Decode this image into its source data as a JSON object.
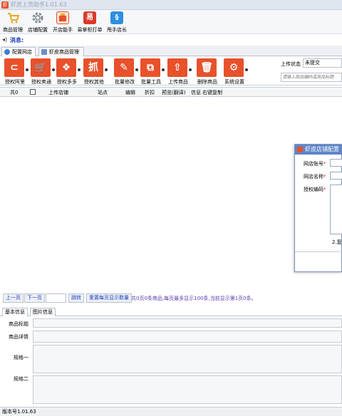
{
  "window": {
    "title": "虾皮上货助手1.01.63"
  },
  "top_toolbar": [
    {
      "label": "商品管理",
      "icon": "cart-icon",
      "color": "#e9a825"
    },
    {
      "label": "店铺配置",
      "icon": "gear-icon",
      "color": "#7d8591"
    },
    {
      "label": "开店能手",
      "icon": "shop-icon",
      "color": "#e8512b"
    },
    {
      "label": "易掌柜打单",
      "icon": "print-icon",
      "color": "#d93a2b"
    },
    {
      "label": "甩手店长",
      "icon": "app-icon",
      "color": "#2d8fe0"
    }
  ],
  "message": {
    "label": "消息:"
  },
  "tabs": [
    {
      "label": "配置网店",
      "active": true
    },
    {
      "label": "虾皮商品管理",
      "active": false
    }
  ],
  "tools": [
    {
      "label": "授权阿里",
      "glyph": "◎",
      "color": "#e8512b"
    },
    {
      "label": "授权卖通",
      "glyph": "⛟",
      "color": "#e8512b"
    },
    {
      "label": "授权多多",
      "glyph": "❖",
      "color": "#e8512b"
    },
    {
      "label": "授权其他",
      "glyph": "抓",
      "color": "#e8512b"
    },
    {
      "label": "批量修改",
      "glyph": "✎",
      "color": "#e8512b"
    },
    {
      "label": "批量工具",
      "glyph": "⧉",
      "color": "#e8512b"
    },
    {
      "label": "上传商品",
      "glyph": "⇧",
      "color": "#e8512b"
    },
    {
      "label": "删除商品",
      "glyph": "🗑",
      "color": "#e8512b"
    },
    {
      "label": "系统设置",
      "glyph": "⚙",
      "color": "#e8512b"
    }
  ],
  "upload_status": {
    "label": "上传状态",
    "value": "未提交"
  },
  "search": {
    "placeholder": "请输入商品编码或商品标题"
  },
  "grid_columns": [
    "共0",
    "上传店铺",
    "站点",
    "编辑",
    "折扣",
    "预览(翻译)",
    "信息",
    "右键复制"
  ],
  "pager": {
    "prev": "上一页",
    "next": "下一页",
    "jump": "跳转",
    "reset": "重置每页显示数量",
    "info": "共0页0条商品,每页最多显示100条,当前显示第1页0条。"
  },
  "info_tabs": [
    {
      "label": "基本信息",
      "active": true
    },
    {
      "label": "图片信息",
      "active": false
    }
  ],
  "fields": [
    {
      "label": "商品标题"
    },
    {
      "label": "商品详情"
    },
    {
      "label": "规格一"
    },
    {
      "label": "规格二"
    }
  ],
  "status": {
    "version": "版本号1.01.63"
  },
  "dialog": {
    "title": "虾皮店铺配置",
    "shop_account_label": "网店账号",
    "shop_name_label": "网店名称",
    "auth_code_label": "授权编码",
    "note": "2.复"
  }
}
